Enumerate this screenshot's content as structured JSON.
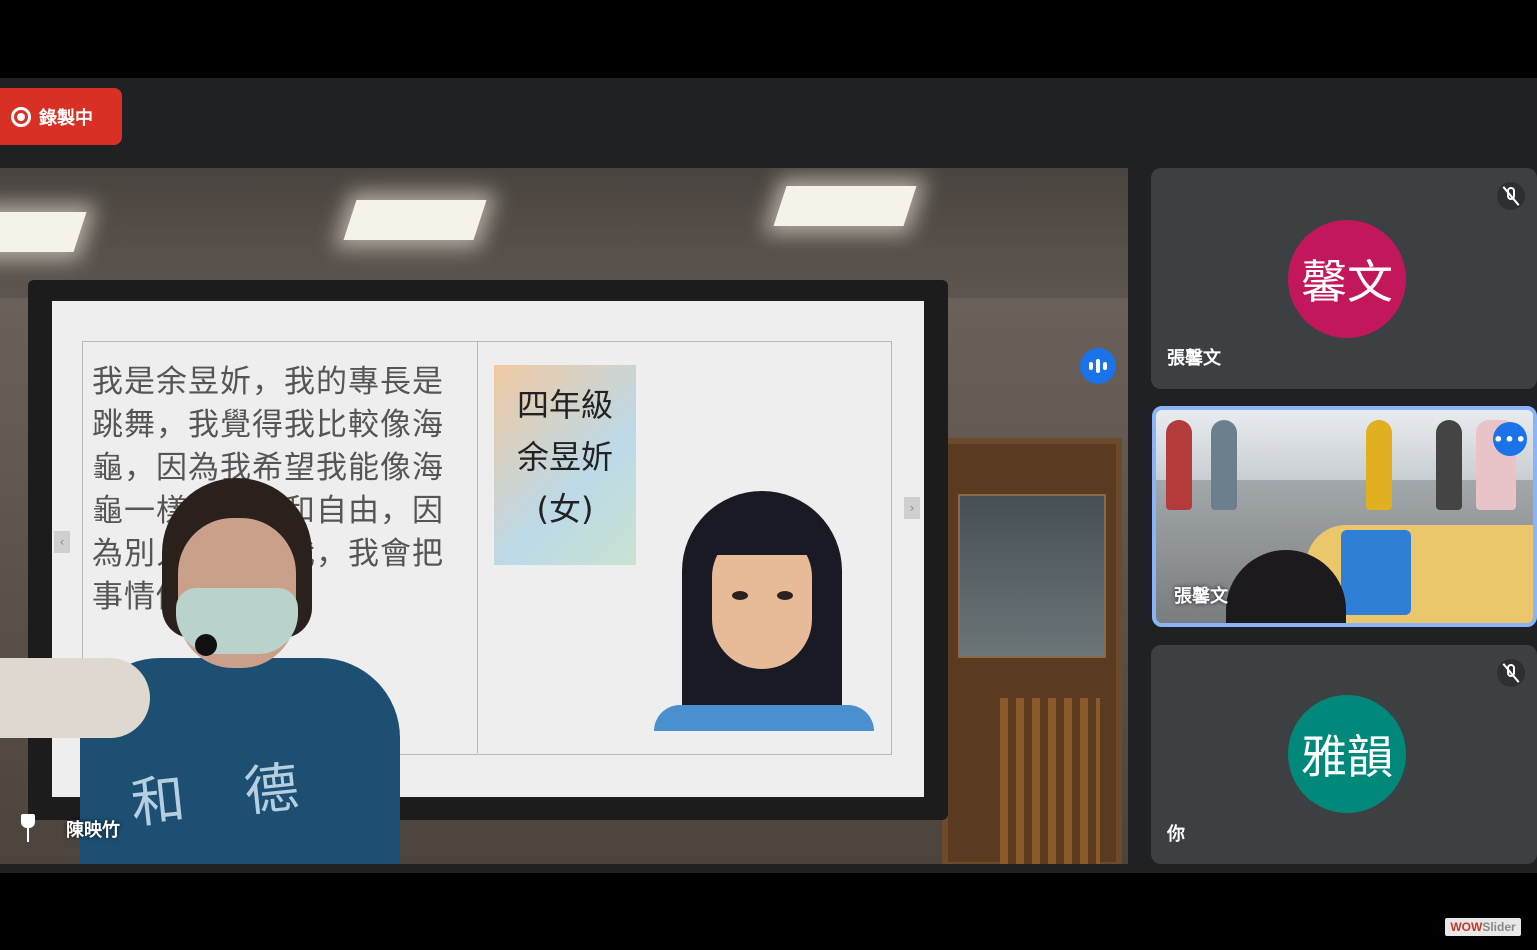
{
  "recording": {
    "label": "錄製中",
    "color": "#d93025"
  },
  "main": {
    "presenter_name": "陳映竹",
    "audio_indicator_color": "#1a73e8",
    "slide": {
      "text": "我是余昱妡，我的專長是跳舞，我覺得我比較像海龜，因為我希望我能像海龜一樣，慢慢和自由，因為別人不會催我，我會把事情做好。",
      "title_lines": [
        "四年級",
        "余昱妡",
        "(女)"
      ]
    },
    "shirt_text": "和德"
  },
  "participants": [
    {
      "id": "tile-1",
      "avatar_text": "馨文",
      "avatar_color": "#c2185b",
      "name": "張馨文",
      "muted": true,
      "icon": "mic-off-icon"
    },
    {
      "id": "tile-2",
      "name": "張馨文",
      "video": true,
      "active_border": "#8ab4f8",
      "more_label": "•••"
    },
    {
      "id": "tile-3",
      "avatar_text": "雅韻",
      "avatar_color": "#00897b",
      "name": "你",
      "muted": true,
      "icon": "mic-off-icon"
    }
  ],
  "watermark": {
    "part_a": "WOW",
    "part_b": "Slider"
  }
}
